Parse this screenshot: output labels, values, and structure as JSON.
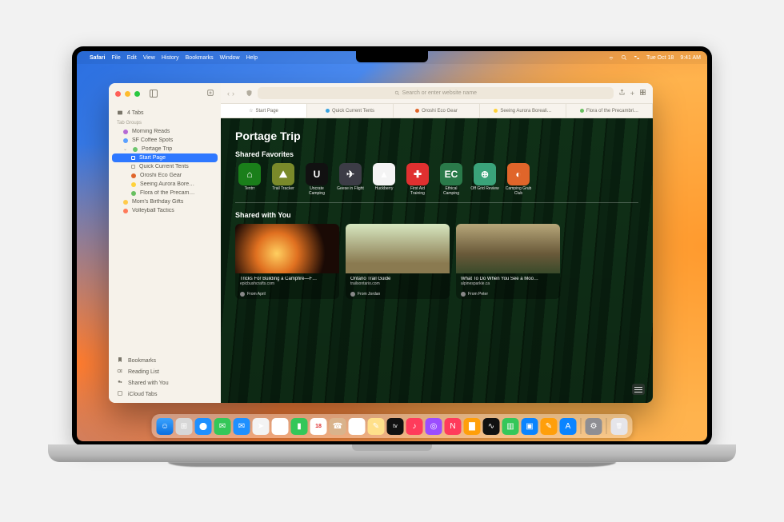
{
  "menubar": {
    "app": "Safari",
    "items": [
      "File",
      "Edit",
      "View",
      "History",
      "Bookmarks",
      "Window",
      "Help"
    ],
    "status": {
      "date": "Tue Oct 18",
      "time": "9:41 AM"
    }
  },
  "toolbar": {
    "search_placeholder": "Search or enter website name"
  },
  "tabs": [
    {
      "label": "Start Page",
      "kind": "star",
      "active": true
    },
    {
      "label": "Quick Current Tents",
      "color": "#3aa3e0"
    },
    {
      "label": "Oroshi Eco Gear",
      "color": "#e0652a"
    },
    {
      "label": "Seeing Aurora Boreali…",
      "color": "#ffd23a"
    },
    {
      "label": "Flora of the Precambri…",
      "color": "#68c060"
    }
  ],
  "sidebar": {
    "tabs_header": "4 Tabs",
    "section_label": "Tab Groups",
    "groups": [
      {
        "label": "Morning Reads",
        "color": "#b56ad4"
      },
      {
        "label": "SF Coffee Spots",
        "color": "#5aa0ff"
      },
      {
        "label": "Portage Trip",
        "color": "#6dc66d",
        "expanded": true,
        "children": [
          {
            "label": "Start Page",
            "selected": true
          },
          {
            "label": "Quick Current Tents"
          },
          {
            "label": "Oroshi Eco Gear",
            "color": "#e0652a"
          },
          {
            "label": "Seeing Aurora Bore…",
            "color": "#ffd23a"
          },
          {
            "label": "Flora of the Precam…",
            "color": "#68c060"
          }
        ]
      },
      {
        "label": "Mom's Birthday Gifts",
        "color": "#ffca4a"
      },
      {
        "label": "Volleyball Tactics",
        "color": "#ff7a5a"
      }
    ],
    "bottom": [
      "Bookmarks",
      "Reading List",
      "Shared with You",
      "iCloud Tabs"
    ]
  },
  "page": {
    "title": "Portage Trip",
    "favorites_title": "Shared Favorites",
    "favorites": [
      {
        "label": "Tentrr",
        "glyph": "⌂",
        "cls": "c-green"
      },
      {
        "label": "Trail Tracker",
        "glyph": "⛰",
        "cls": "c-olive"
      },
      {
        "label": "Uncrate Camping",
        "glyph": "U",
        "cls": "c-black"
      },
      {
        "label": "Geese in Flight",
        "glyph": "✈",
        "cls": "c-dgray"
      },
      {
        "label": "Huckberry",
        "glyph": "▲",
        "cls": "c-white"
      },
      {
        "label": "First Aid Training",
        "glyph": "✚",
        "cls": "c-red"
      },
      {
        "label": "Ethical Camping",
        "glyph": "EC",
        "cls": "c-teal"
      },
      {
        "label": "Off Grid Review",
        "glyph": "⊕",
        "cls": "c-mint"
      },
      {
        "label": "Camping Grub Club",
        "glyph": "◐",
        "cls": "c-orange"
      }
    ],
    "shared_title": "Shared with You",
    "shared": [
      {
        "title": "Tricks For Building a Campfire—F…",
        "source": "epicbushcrafts.com",
        "from": "From April",
        "img": "img1"
      },
      {
        "title": "Ontario Trail Guide",
        "source": "trailsontario.com",
        "from": "From Jordan",
        "img": "img2"
      },
      {
        "title": "What To Do When You See a Moo…",
        "source": "alpinesparkle.ca",
        "from": "From Peter",
        "img": "img3"
      }
    ]
  },
  "dock": [
    {
      "name": "finder",
      "bg": "linear-gradient(#3aa3ff,#0a6fe0)",
      "glyph": "☺"
    },
    {
      "name": "launchpad",
      "bg": "#d7d7d7",
      "glyph": "⊞"
    },
    {
      "name": "safari",
      "bg": "radial-gradient(circle,#fff 30%,#1e90ff 32%)",
      "glyph": ""
    },
    {
      "name": "messages",
      "bg": "#34c759",
      "glyph": "✉"
    },
    {
      "name": "mail",
      "bg": "#1e90ff",
      "glyph": "✉"
    },
    {
      "name": "maps",
      "bg": "#f3f3f3",
      "glyph": "➤"
    },
    {
      "name": "photos",
      "bg": "#fff",
      "glyph": "✿"
    },
    {
      "name": "facetime",
      "bg": "#34c759",
      "glyph": "▮"
    },
    {
      "name": "calendar",
      "bg": "#fff",
      "glyph": "18"
    },
    {
      "name": "contacts",
      "bg": "#d9b38c",
      "glyph": "☎"
    },
    {
      "name": "reminders",
      "bg": "#fff",
      "glyph": "☰"
    },
    {
      "name": "notes",
      "bg": "#ffe08a",
      "glyph": "✎"
    },
    {
      "name": "tv",
      "bg": "#111",
      "glyph": "tv"
    },
    {
      "name": "music",
      "bg": "#ff3b5b",
      "glyph": "♪"
    },
    {
      "name": "podcasts",
      "bg": "#9b4dff",
      "glyph": "◎"
    },
    {
      "name": "news",
      "bg": "#ff3b5b",
      "glyph": "N"
    },
    {
      "name": "books",
      "bg": "#ff9f0a",
      "glyph": "▇"
    },
    {
      "name": "stocks",
      "bg": "#111",
      "glyph": "∿"
    },
    {
      "name": "numbers",
      "bg": "#34c759",
      "glyph": "▥"
    },
    {
      "name": "keynote",
      "bg": "#0a84ff",
      "glyph": "▣"
    },
    {
      "name": "pages",
      "bg": "#ff9f0a",
      "glyph": "✎"
    },
    {
      "name": "appstore",
      "bg": "#0a84ff",
      "glyph": "A"
    },
    {
      "name": "sep"
    },
    {
      "name": "settings",
      "bg": "#8e8e93",
      "glyph": "⚙"
    },
    {
      "name": "sep"
    },
    {
      "name": "trash",
      "bg": "#e5e5ea",
      "glyph": "🗑"
    }
  ]
}
